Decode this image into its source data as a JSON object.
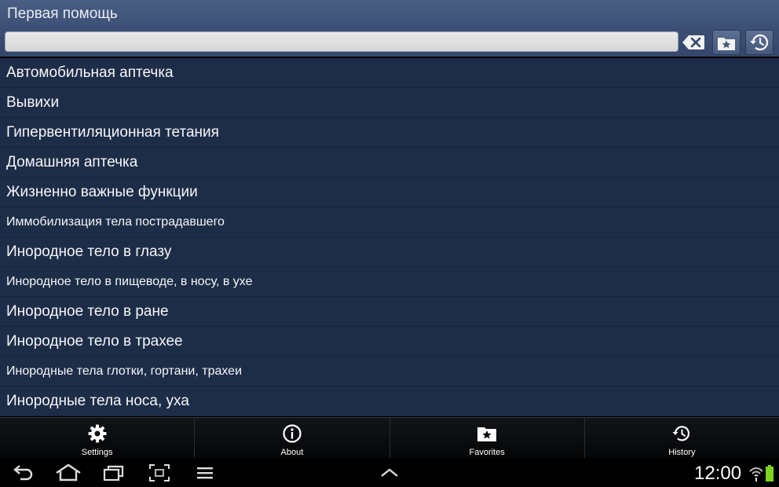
{
  "app": {
    "title": "Первая помощь"
  },
  "search": {
    "value": "",
    "placeholder": ""
  },
  "toolbar": {
    "clear_icon": "backspace-x-icon",
    "favorites_icon": "star-folder-icon",
    "history_icon": "history-clock-icon"
  },
  "list": {
    "items": [
      {
        "label": "Автомобильная аптечка",
        "size": "normal"
      },
      {
        "label": "Вывихи",
        "size": "normal"
      },
      {
        "label": "Гипервентиляционная тетания",
        "size": "normal"
      },
      {
        "label": "Домашняя аптечка",
        "size": "normal"
      },
      {
        "label": "Жизненно важные функции",
        "size": "normal"
      },
      {
        "label": "Иммобилизация тела пострадавшего",
        "size": "small"
      },
      {
        "label": "Инородное тело в глазу",
        "size": "normal"
      },
      {
        "label": "Инородное тело в пищеводе, в носу, в ухе",
        "size": "small"
      },
      {
        "label": "Инородное тело в ране",
        "size": "normal"
      },
      {
        "label": "Инородное тело в трахее",
        "size": "normal"
      },
      {
        "label": "Инородные тела глотки, гортани, трахеи",
        "size": "small"
      },
      {
        "label": "Инородные тела носа, уха",
        "size": "normal"
      }
    ]
  },
  "bottom_nav": {
    "settings": "Settings",
    "about": "About",
    "favorites": "Favorites",
    "history": "History"
  },
  "system_bar": {
    "time": "12:00"
  },
  "colors": {
    "title_bar": "#4b5f86",
    "list_background": "#1e2d47",
    "battery": "#7ed321"
  }
}
